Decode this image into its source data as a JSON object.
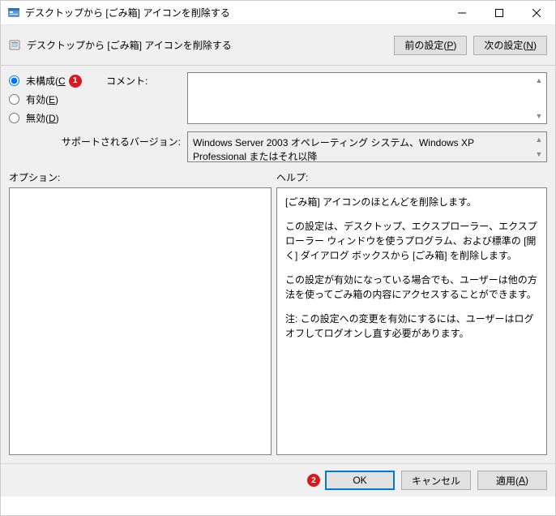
{
  "window": {
    "title": "デスクトップから [ごみ箱] アイコンを削除する"
  },
  "toolbar": {
    "policy_title": "デスクトップから [ごみ箱] アイコンを削除する",
    "prev_label_pre": "前の設定(",
    "prev_label_key": "P",
    "prev_label_post": ")",
    "next_label_pre": "次の設定(",
    "next_label_key": "N",
    "next_label_post": ")"
  },
  "config": {
    "radios": {
      "not_configured_pre": "未構成(",
      "not_configured_key": "C",
      "not_configured_post": ")",
      "enabled_pre": "有効(",
      "enabled_key": "E",
      "enabled_post": ")",
      "disabled_pre": "無効(",
      "disabled_key": "D",
      "disabled_post": ")"
    },
    "comment_label": "コメント:",
    "comment_value": "",
    "supported_label": "サポートされるバージョン:",
    "supported_value": "Windows Server 2003 オペレーティング システム、Windows XP Professional またはそれ以降"
  },
  "lower": {
    "options_label": "オプション:",
    "help_label": "ヘルプ:",
    "help_p1": "[ごみ箱] アイコンのほとんどを削除します。",
    "help_p2": "この設定は、デスクトップ、エクスプローラー、エクスプローラー ウィンドウを使うプログラム、および標準の [開く] ダイアログ ボックスから [ごみ箱] を削除します。",
    "help_p3": "この設定が有効になっている場合でも、ユーザーは他の方法を使ってごみ箱の内容にアクセスすることができます。",
    "help_p4": "注: この設定への変更を有効にするには、ユーザーはログオフしてログオンし直す必要があります。"
  },
  "buttons": {
    "ok": "OK",
    "cancel": "キャンセル",
    "apply_pre": "適用(",
    "apply_key": "A",
    "apply_post": ")"
  },
  "badges": {
    "one": "1",
    "two": "2"
  }
}
